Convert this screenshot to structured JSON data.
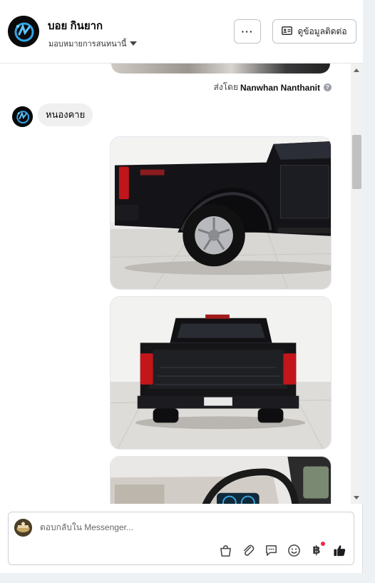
{
  "header": {
    "name": "บอย กินยาก",
    "assign_label": "มอบหมายการสนทนานี้",
    "more_label": "···",
    "contact_label": "ดูข้อมูลติดต่อ"
  },
  "chat": {
    "sent_by_prefix": "ส่งโดย",
    "sent_by_name": "Nanwhan Nanthanit",
    "help_symbol": "?",
    "incoming_message": "หนองคาย",
    "photos": [
      {
        "subject": "pickup-truck-rear-side-view"
      },
      {
        "subject": "pickup-truck-bed-rear-view"
      },
      {
        "subject": "pickup-truck-interior-dashboard"
      }
    ]
  },
  "composer": {
    "placeholder": "ตอบกลับใน Messenger...",
    "baht_symbol": "฿",
    "tools": [
      "bag-icon",
      "paperclip-icon",
      "chat-bubble-icon",
      "emoji-icon",
      "baht-icon",
      "thumbs-up-icon"
    ]
  },
  "colors": {
    "accent": "#1877f2",
    "notification": "#f02849",
    "bubble": "#f0f0f0"
  }
}
